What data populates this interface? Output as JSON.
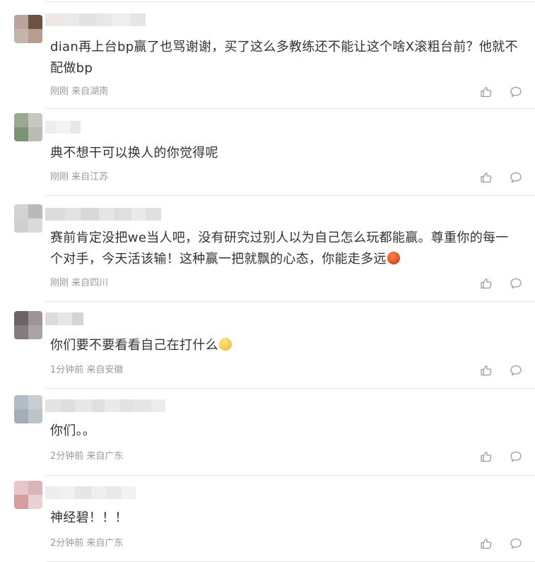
{
  "comments": [
    {
      "text": "dian再上台bp赢了也骂谢谢，买了这么多教练还不能让这个啥X滚粗台前？他就不配做bp",
      "time": "刚刚",
      "location": "来自湖南",
      "avatar_colors": [
        "#b8a49a",
        "#6e5240",
        "#c4b4ae",
        "#b89c90"
      ],
      "name_colors": [
        "#ece8e6",
        "#eaeaea",
        "#e2e2e2",
        "#e8e8e8",
        "#eeeeee",
        "#e6e6e6"
      ]
    },
    {
      "text": "典不想干可以换人的你觉得呢",
      "time": "刚刚",
      "location": "来自江苏",
      "avatar_colors": [
        "#9aaa90",
        "#c7c9c0",
        "#7a9478",
        "#bdbcb4"
      ],
      "name_colors": [
        "#ededed",
        "#f3f3f3",
        "#e8e8e8"
      ]
    },
    {
      "text": "赛前肯定没把we当人吧，没有研究过别人以为自己怎么玩都能赢。尊重你的每一个对手，今天活该输！这种赢一把就飘的心态，你能走多远",
      "emoji": "angry",
      "time": "刚刚",
      "location": "来自四川",
      "avatar_colors": [
        "#d2d2d2",
        "#b9b9b9",
        "#cfcfcf",
        "#dadada"
      ],
      "name_colors": [
        "#dcdcdc",
        "#e3e3e3",
        "#d8d8d8",
        "#e6e6e6",
        "#dedede",
        "#eaeaea",
        "#e0e0e0"
      ]
    },
    {
      "text": "你们要不要看看自己在打什么",
      "emoji": "think",
      "time": "1分钟前",
      "location": "来自安徽",
      "avatar_colors": [
        "#6b6466",
        "#9c9497",
        "#857a7e",
        "#aaa3a6"
      ],
      "name_colors": [
        "#dcdcdc",
        "#e6e6e6",
        "#d4d4d4"
      ]
    },
    {
      "text": "你们。。",
      "time": "2分钟前",
      "location": "来自广东",
      "avatar_colors": [
        "#b3bcc4",
        "#c7ced3",
        "#a3aeb8",
        "#bcc4ca"
      ],
      "name_colors": [
        "#e4e4e4",
        "#dedede",
        "#e8e8e8",
        "#e0e0e0",
        "#eaeaea",
        "#e2e2e2",
        "#e6e6e6",
        "#ececec"
      ]
    },
    {
      "text": "神经碧！！！",
      "time": "2分钟前",
      "location": "来自广东",
      "avatar_colors": [
        "#e6c6c8",
        "#d9b4b8",
        "#d79ca0",
        "#ead2d4"
      ],
      "name_colors": [
        "#ededed",
        "#f0f0f0",
        "#e6e6e6",
        "#eeeeee",
        "#e9e9e9",
        "#f2f2f2"
      ]
    }
  ],
  "icons": {
    "like": "thumbs-up-icon",
    "reply": "comment-bubble-icon"
  },
  "colors": {
    "text": "#333333",
    "meta": "#999999",
    "divider": "#e6e6e6",
    "icon": "#999999"
  }
}
